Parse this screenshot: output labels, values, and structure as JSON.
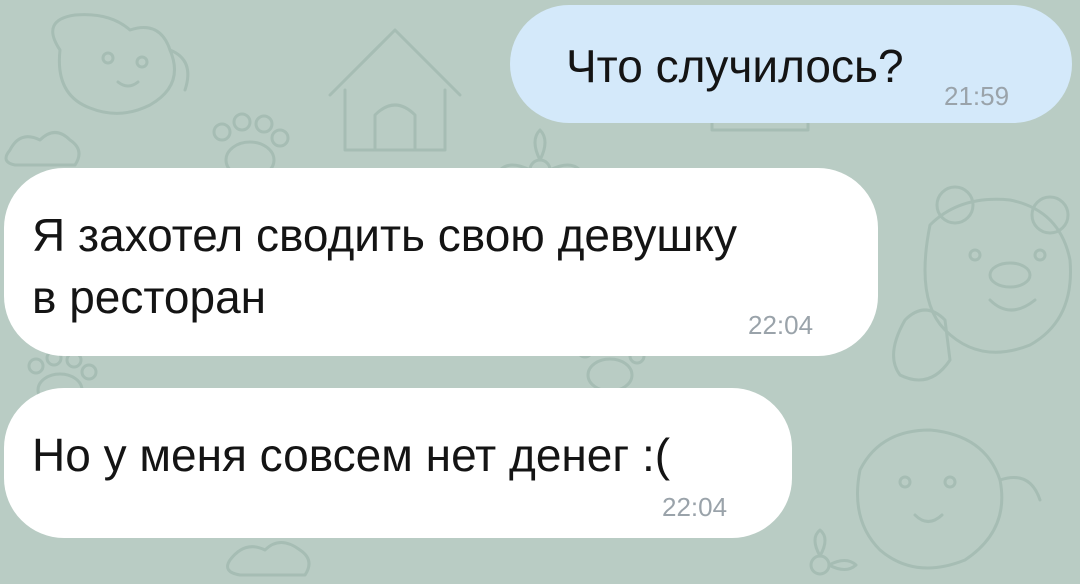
{
  "chat": {
    "wallpaper_color": "#b9ccc4",
    "wallpaper_icons": [
      "dog-face-icon",
      "doghouse-icon",
      "paw-icon",
      "bear-face-icon",
      "hand-icon",
      "cloud-icon",
      "flower-icon"
    ],
    "messages": [
      {
        "direction": "outgoing",
        "text": "Что случилось?",
        "time": "21:59",
        "color": "#d4e9fa"
      },
      {
        "direction": "incoming",
        "lines": [
          "Я захотел сводить свою девушку",
          "в ресторан"
        ],
        "time": "22:04",
        "color": "#ffffff"
      },
      {
        "direction": "incoming",
        "text": "Но у меня совсем нет денег :(",
        "time": "22:04",
        "color": "#ffffff"
      }
    ]
  }
}
